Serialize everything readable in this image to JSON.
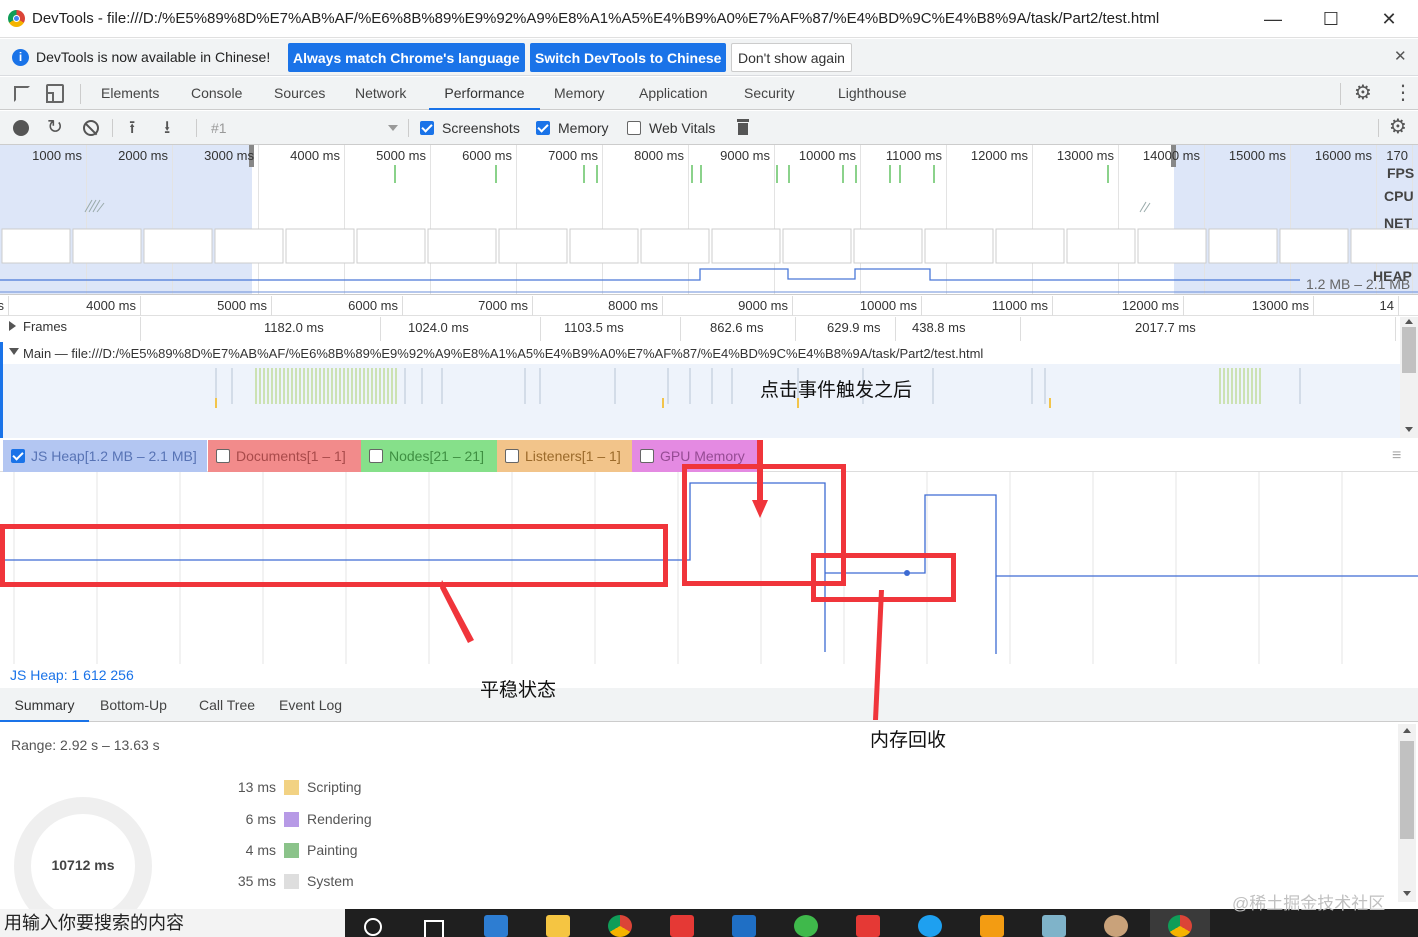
{
  "window": {
    "title": "DevTools - file:///D:/%E5%89%8D%E7%AB%AF/%E6%8B%89%E9%92%A9%E8%A1%A5%E4%B9%A0%E7%AF%87/%E4%BD%9C%E4%B8%9A/task/Part2/test.html",
    "minimize": "—",
    "maximize": "☐",
    "close": "✕"
  },
  "infobar": {
    "message": "DevTools is now available in Chinese!",
    "match_btn": "Always match Chrome's language",
    "switch_btn": "Switch DevTools to Chinese",
    "dont_show": "Don't show again",
    "close": "✕"
  },
  "tabs": [
    "Elements",
    "Console",
    "Sources",
    "Network",
    "Performance",
    "Memory",
    "Application",
    "Security",
    "Lighthouse"
  ],
  "active_tab": "Performance",
  "toolbar": {
    "recording": "#1",
    "screenshots": "Screenshots",
    "memory": "Memory",
    "web_vitals": "Web Vitals"
  },
  "overview": {
    "ticks": [
      "1000 ms",
      "2000 ms",
      "3000 ms",
      "4000 ms",
      "5000 ms",
      "6000 ms",
      "7000 ms",
      "8000 ms",
      "9000 ms",
      "10000 ms",
      "11000 ms",
      "12000 ms",
      "13000 ms",
      "14000 ms",
      "15000 ms",
      "16000 ms",
      "170"
    ],
    "fps": "FPS",
    "cpu": "CPU",
    "net": "NET",
    "heap": "HEAP",
    "heap_range": "1.2 MB – 2.1 MB"
  },
  "flame": {
    "ticks": [
      "s",
      "4000 ms",
      "5000 ms",
      "6000 ms",
      "7000 ms",
      "8000 ms",
      "9000 ms",
      "10000 ms",
      "11000 ms",
      "12000 ms",
      "13000 ms",
      "14"
    ],
    "frames_label": "Frames",
    "frame_times": [
      "1182.0 ms",
      "1024.0 ms",
      "1103.5 ms",
      "862.6 ms",
      "629.9 ms",
      "438.8 ms",
      "2017.7 ms"
    ],
    "main_label": "Main — file:///D:/%E5%89%8D%E7%AB%AF/%E6%8B%89%E9%92%A9%E8%A1%A5%E4%B9%A0%E7%AF%87/%E4%BD%9C%E4%B8%9A/task/Part2/test.html"
  },
  "counters": [
    {
      "label": "JS Heap[1.2 MB – 2.1 MB]",
      "checked": true,
      "color": "#b3c6f2"
    },
    {
      "label": "Documents[1 – 1]",
      "checked": false,
      "color": "#f28b8b"
    },
    {
      "label": "Nodes[21 – 21]",
      "checked": false,
      "color": "#86e08a"
    },
    {
      "label": "Listeners[1 – 1]",
      "checked": false,
      "color": "#f2c48a"
    },
    {
      "label": "GPU Memory",
      "checked": false,
      "color": "#e48ae2"
    }
  ],
  "heap_readout": "JS Heap: 1 612 256",
  "bottom_tabs": [
    "Summary",
    "Bottom-Up",
    "Call Tree",
    "Event Log"
  ],
  "summary": {
    "range": "Range: 2.92 s – 13.63 s",
    "total": "10712 ms",
    "rows": [
      {
        "ms": "13 ms",
        "label": "Scripting",
        "color": "#f2d283"
      },
      {
        "ms": "6 ms",
        "label": "Rendering",
        "color": "#b79ae6"
      },
      {
        "ms": "4 ms",
        "label": "Painting",
        "color": "#8bc38a"
      },
      {
        "ms": "35 ms",
        "label": "System",
        "color": "#dedede"
      }
    ]
  },
  "annotations": {
    "after_click": "点击事件触发之后",
    "stable": "平稳状态",
    "gc": "内存回收"
  },
  "taskbar": {
    "search": "用输入你要搜索的内容"
  },
  "watermark": "@稀土掘金技术社区"
}
